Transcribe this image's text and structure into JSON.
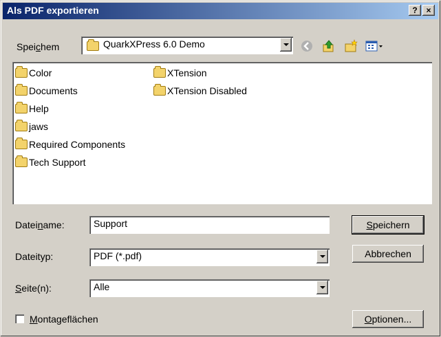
{
  "window": {
    "title": "Als PDF exportieren",
    "help_btn": "?",
    "close_btn": "×"
  },
  "save_in": {
    "label_pre": "Spei",
    "label_u": "c",
    "label_post": "hem",
    "value": "QuarkXPress 6.0 Demo"
  },
  "files_col1": [
    "Color",
    "Documents",
    "Help",
    "jaws",
    "Required Components",
    "Tech Support"
  ],
  "files_col2": [
    "XTension",
    "XTension Disabled"
  ],
  "filename": {
    "label_pre": "Datei",
    "label_u": "n",
    "label_post": "ame:",
    "value": "Support"
  },
  "filetype": {
    "label": "Dateityp:",
    "value": "PDF (*.pdf)"
  },
  "pages": {
    "label_u": "S",
    "label_post": "eite(n):",
    "value": "Alle"
  },
  "spreads": {
    "label_u": "M",
    "label_post": "ontageflächen",
    "checked": false
  },
  "buttons": {
    "save_u": "S",
    "save_post": "peichern",
    "cancel": "Abbrechen",
    "options_u": "O",
    "options_post": "ptionen..."
  }
}
